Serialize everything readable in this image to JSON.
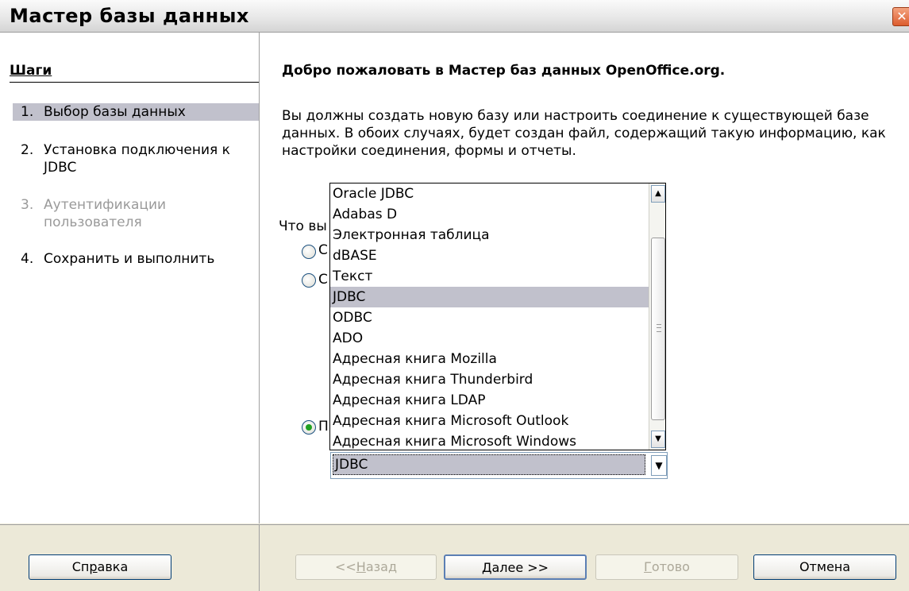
{
  "window": {
    "title": "Мастер базы данных",
    "close_glyph": "✕"
  },
  "steps": {
    "title": "Шаги",
    "items": [
      {
        "num": "1.",
        "label": "Выбор базы данных",
        "state": "active"
      },
      {
        "num": "2.",
        "label": "Установка подключения к JDBC",
        "state": "normal"
      },
      {
        "num": "3.",
        "label": "Аутентификации пользователя",
        "state": "disabled"
      },
      {
        "num": "4.",
        "label": "Сохранить и выполнить",
        "state": "normal"
      }
    ]
  },
  "content": {
    "heading": "Добро пожаловать в Мастер баз данных OpenOffice.org.",
    "intro": "Вы должны создать новую базу или настроить соединение к существующей базе данных. В обоих случаях, будет создан файл, содержащий такую информацию, как настройки соединения, формы и отчеты.",
    "question": "Что вы",
    "radio_partials": [
      "С",
      "С",
      "П"
    ],
    "dropdown": {
      "selected": "JDBC",
      "options": [
        "Oracle JDBC",
        "Adabas D",
        "Электронная таблица",
        "dBASE",
        "Текст",
        "JDBC",
        "ODBC",
        "ADO",
        "Адресная книга Mozilla",
        "Адресная книга Thunderbird",
        "Адресная книга LDAP",
        "Адресная книга Microsoft Outlook",
        "Адресная книга Microsoft Windows"
      ]
    }
  },
  "buttons": {
    "help": {
      "pre": "Сп",
      "mn": "р",
      "post": "авка"
    },
    "back": {
      "pre": "<<",
      "mn": "Н",
      "post": "азад"
    },
    "next": {
      "pre": "",
      "mn": "Д",
      "post": "алее >>"
    },
    "finish": {
      "pre": "",
      "mn": "Г",
      "post": "отово"
    },
    "cancel": {
      "pre": "",
      "mn": "",
      "post": "Отмена"
    }
  },
  "colors": {
    "selection": "#c1c1cc",
    "radio_checked": "#21a121",
    "frame": "#ece9d8"
  }
}
